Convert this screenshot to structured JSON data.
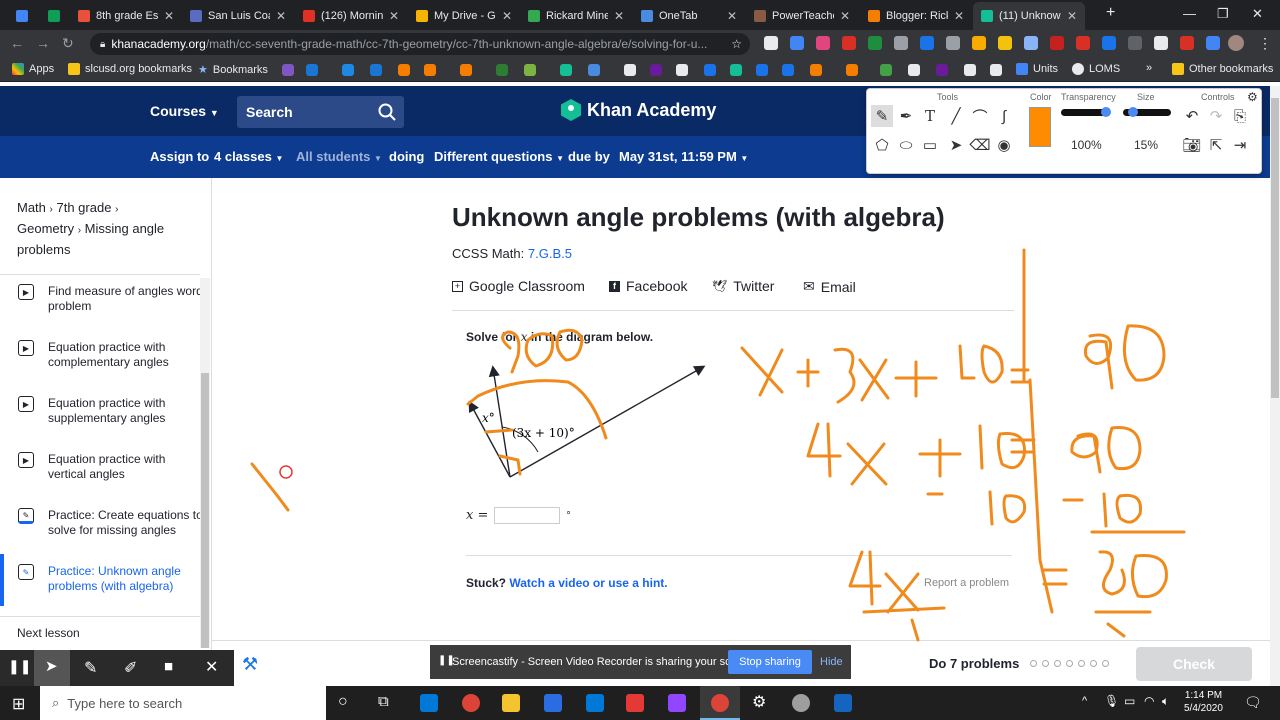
{
  "browser": {
    "tabs": [
      {
        "label": "8th grade Est",
        "color": "#e84f3d"
      },
      {
        "label": "San Luis Coas",
        "color": "#5b6bc0"
      },
      {
        "label": "(126) Mornin",
        "color": "#e03124"
      },
      {
        "label": "My Drive - G",
        "color": "#f4b400"
      },
      {
        "label": "Rickard Mine",
        "color": "#34a853"
      },
      {
        "label": "OneTab",
        "color": "#4a8be0"
      },
      {
        "label": "PowerTeacher",
        "color": "#8a5a44"
      },
      {
        "label": "Blogger: Rick",
        "color": "#f57d00"
      },
      {
        "label": "(11) Unknow",
        "color": "#14bf96"
      }
    ],
    "url_domain": "khanacademy.org",
    "url_path": "/math/cc-seventh-grade-math/cc-7th-geometry/cc-7th-unknown-angle-algebra/e/solving-for-u...",
    "bookmarks": {
      "apps": "Apps",
      "slcusd": "slcusd.org bookmarks",
      "bookmarks": "Bookmarks",
      "units": "Units",
      "loms": "LOMS",
      "other": "Other bookmarks",
      "more": "»"
    }
  },
  "ka": {
    "courses": "Courses",
    "search_placeholder": "Search",
    "logo": "Khan Academy",
    "assign": {
      "assign_to": "Assign to",
      "classes": "4 classes",
      "students": "All students",
      "doing": "doing",
      "questions": "Different questions",
      "due_by": "due by",
      "due_date": "May 31st, 11:59 PM"
    }
  },
  "sidebar": {
    "crumbs": {
      "math": "Math",
      "grade": "7th grade",
      "geometry": "Geometry",
      "missing": "Missing angle problems"
    },
    "lessons": [
      {
        "label": "Find measure of angles word problem",
        "kind": "video"
      },
      {
        "label": "Equation practice with complementary angles",
        "kind": "video"
      },
      {
        "label": "Equation practice with supplementary angles",
        "kind": "video"
      },
      {
        "label": "Equation practice with vertical angles",
        "kind": "video"
      },
      {
        "label": "Practice: Create equations to solve for missing angles",
        "kind": "exercise"
      },
      {
        "label": "Practice: Unknown angle problems (with algebra)",
        "kind": "exercise"
      }
    ],
    "next_lesson": "Next lesson"
  },
  "main": {
    "title": "Unknown angle problems (with algebra)",
    "ccss_label": "CCSS Math:",
    "ccss_code": "7.G.B.5",
    "share": {
      "classroom": "Google Classroom",
      "facebook": "Facebook",
      "twitter": "Twitter",
      "email": "Email"
    },
    "prompt_a": "Solve for",
    "prompt_var": "x",
    "prompt_b": "in the diagram below.",
    "diagram_x_label": "x°",
    "diagram_expr": "(3x + 10)°",
    "answer_label": "x =",
    "answer_value": "",
    "answer_unit": "°",
    "stuck": "Stuck?",
    "hint_link": "Watch a video or use a hint.",
    "report": "Report a problem"
  },
  "footer": {
    "progress": "Do 7 problems",
    "check": "Check"
  },
  "screencastify": {
    "text": "Screencastify - Screen Video Recorder is sharing your screen.",
    "stop": "Stop sharing",
    "hide": "Hide"
  },
  "annotation": {
    "tools_label": "Tools",
    "color_label": "Color",
    "transparency_label": "Transparency",
    "size_label": "Size",
    "controls_label": "Controls",
    "transparency_value": "100%",
    "size_value": "15%",
    "pen_color": "#ff8c00"
  },
  "taskbar": {
    "search_placeholder": "Type here to search",
    "time": "1:14 PM",
    "date": "5/4/2020"
  }
}
